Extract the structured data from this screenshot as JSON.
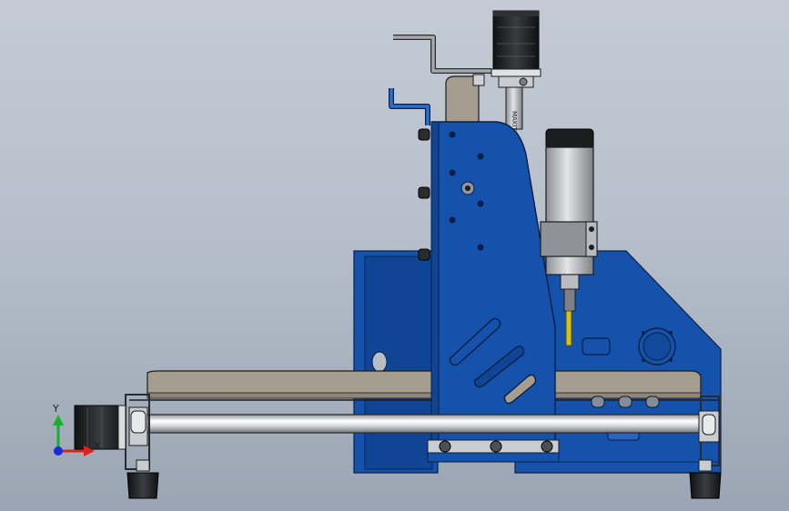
{
  "viewport": {
    "background_top": "#c4cbd5",
    "background_bottom": "#9aa5b3"
  },
  "model": {
    "part_color_blue": "#1450a8",
    "part_color_tan": "#a29a8c",
    "part_color_steel": "#d8dadd",
    "motor_color_black": "#1e1f22",
    "spindle_stamp_text": "MAKITA"
  },
  "triad": {
    "x_label": "X",
    "y_label": "Y",
    "x_color": "#e0201c",
    "y_color": "#16b02a",
    "z_color": "#1a2ae0",
    "icon": "coordinate-triad-icon"
  }
}
